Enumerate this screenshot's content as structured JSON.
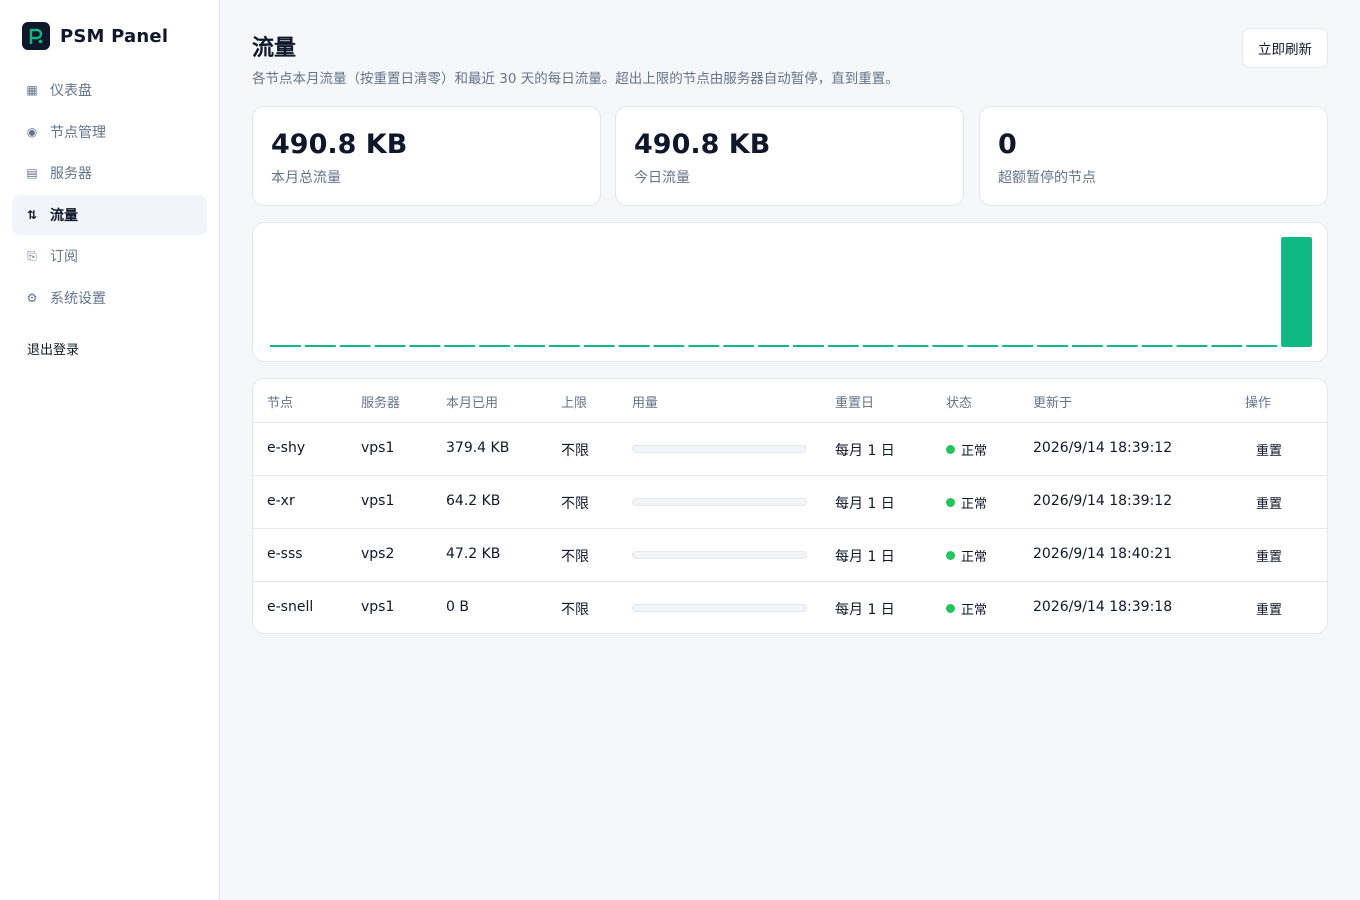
{
  "app": {
    "name": "PSM Panel",
    "logo_icon": "p-logo-icon"
  },
  "sidebar": {
    "items": [
      {
        "label": "仪表盘",
        "icon": "grid-icon",
        "glyph": "▦",
        "active": false
      },
      {
        "label": "节点管理",
        "icon": "node-icon",
        "glyph": "◉",
        "active": false
      },
      {
        "label": "服务器",
        "icon": "server-icon",
        "glyph": "▤",
        "active": false
      },
      {
        "label": "流量",
        "icon": "swap-arrows-icon",
        "glyph": "⇅",
        "active": true
      },
      {
        "label": "订阅",
        "icon": "document-icon",
        "glyph": "⎘",
        "active": false
      },
      {
        "label": "系统设置",
        "icon": "gear-icon",
        "glyph": "⚙",
        "active": false
      }
    ],
    "logout_label": "退出登录"
  },
  "header": {
    "title": "流量",
    "description": "各节点本月流量（按重置日清零）和最近 30 天的每日流量。超出上限的节点由服务器自动暂停，直到重置。",
    "refresh_label": "立即刷新"
  },
  "stats": [
    {
      "value": "490.8 KB",
      "label": "本月总流量"
    },
    {
      "value": "490.8 KB",
      "label": "今日流量"
    },
    {
      "value": "0",
      "label": "超额暂停的节点"
    }
  ],
  "chart_data": {
    "type": "bar",
    "days": 30,
    "values_kb": [
      0,
      0,
      0,
      0,
      0,
      0,
      0,
      0,
      0,
      0,
      0,
      0,
      0,
      0,
      0,
      0,
      0,
      0,
      0,
      0,
      0,
      0,
      0,
      0,
      0,
      0,
      0,
      0,
      0,
      490.8
    ],
    "color": "#10b981"
  },
  "table": {
    "headers": [
      "节点",
      "服务器",
      "本月已用",
      "上限",
      "用量",
      "重置日",
      "状态",
      "更新于",
      "操作"
    ],
    "rows": [
      {
        "node": "e-shy",
        "server": "vps1",
        "used": "379.4 KB",
        "limit": "不限",
        "usage_pct": 0,
        "reset_day": "每月 1 日",
        "status": "正常",
        "updated": "2026/9/14 18:39:12",
        "action": "重置"
      },
      {
        "node": "e-xr",
        "server": "vps1",
        "used": "64.2 KB",
        "limit": "不限",
        "usage_pct": 0,
        "reset_day": "每月 1 日",
        "status": "正常",
        "updated": "2026/9/14 18:39:12",
        "action": "重置"
      },
      {
        "node": "e-sss",
        "server": "vps2",
        "used": "47.2 KB",
        "limit": "不限",
        "usage_pct": 0,
        "reset_day": "每月 1 日",
        "status": "正常",
        "updated": "2026/9/14 18:40:21",
        "action": "重置"
      },
      {
        "node": "e-snell",
        "server": "vps1",
        "used": "0 B",
        "limit": "不限",
        "usage_pct": 0,
        "reset_day": "每月 1 日",
        "status": "正常",
        "updated": "2026/9/14 18:39:18",
        "action": "重置"
      }
    ]
  }
}
